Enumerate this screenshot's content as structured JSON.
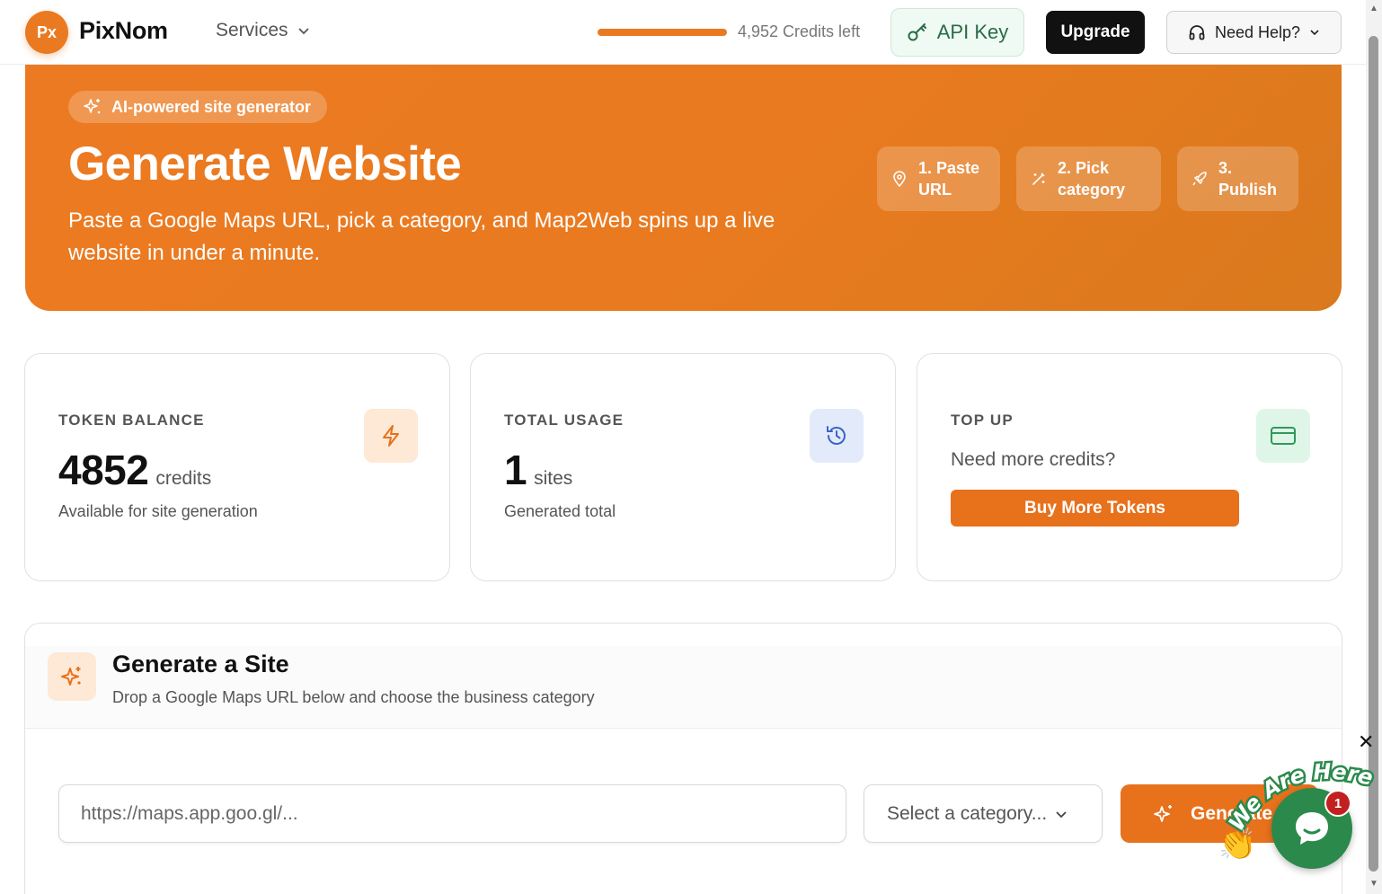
{
  "brand": {
    "badge": "Px",
    "name": "PixNom"
  },
  "nav": {
    "services_label": "Services"
  },
  "credits": {
    "text": "4,952 Credits left",
    "bar_fill_fraction": 1.0
  },
  "header_buttons": {
    "api_key": "API Key",
    "upgrade": "Upgrade",
    "help": "Need Help?"
  },
  "hero": {
    "pill": "AI-powered site generator",
    "title": "Generate Website",
    "subtitle": "Paste a Google Maps URL, pick a category, and Map2Web spins up a live website in under a minute.",
    "steps": [
      {
        "line1": "1. Paste",
        "line2": "URL",
        "icon": "map-pin-icon"
      },
      {
        "line1": "2. Pick",
        "line2": "category",
        "icon": "wand-icon"
      },
      {
        "line1": "3.",
        "line2": "Publish",
        "icon": "rocket-icon"
      }
    ]
  },
  "stats": {
    "balance": {
      "label": "TOKEN BALANCE",
      "value": "4852",
      "unit": "credits",
      "desc": "Available for site generation",
      "icon": "lightning-icon"
    },
    "usage": {
      "label": "TOTAL USAGE",
      "value": "1",
      "unit": "sites",
      "desc": "Generated total",
      "icon": "history-icon"
    },
    "topup": {
      "label": "TOP UP",
      "question": "Need more credits?",
      "button": "Buy More Tokens",
      "icon": "credit-card-icon"
    }
  },
  "generate": {
    "title": "Generate a Site",
    "subtitle": "Drop a Google Maps URL below and choose the business category",
    "url_placeholder": "https://maps.app.goo.gl/...",
    "category_placeholder": "Select a category...",
    "button": "Generate"
  },
  "chat": {
    "badge_count": "1",
    "tagline": "We Are Here!"
  },
  "colors": {
    "accent": "#e8711c",
    "dark": "#111111",
    "api_bg": "#eefaf3",
    "chat_green": "#2b8a4b"
  }
}
